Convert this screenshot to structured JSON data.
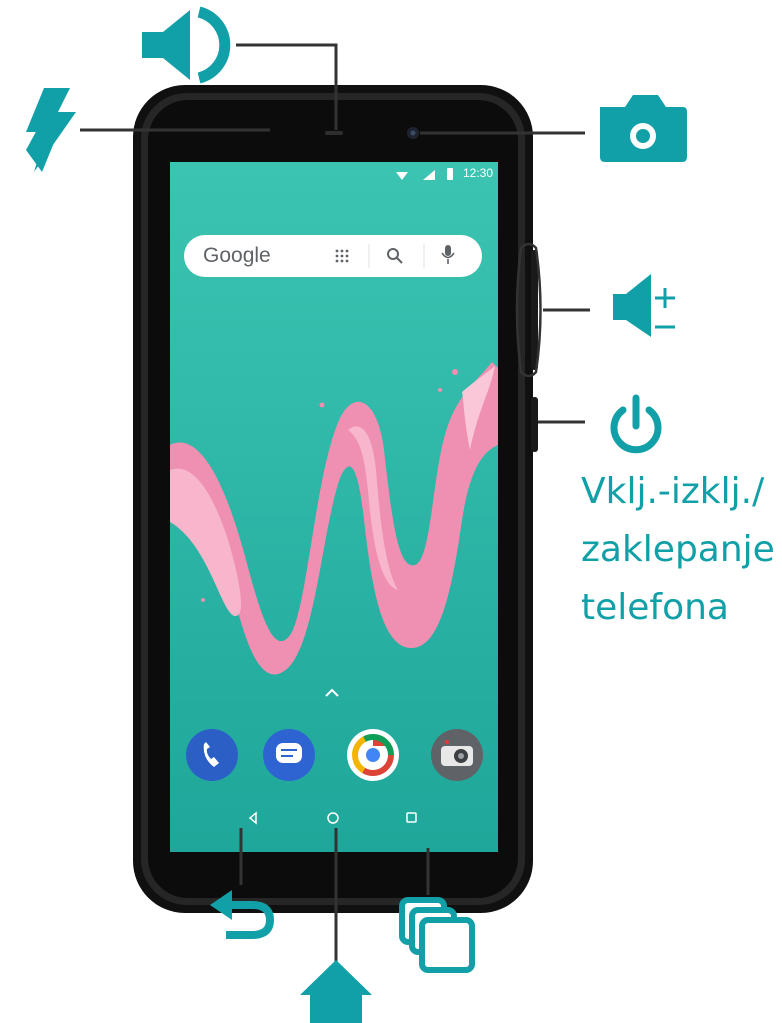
{
  "colors": {
    "accent": "#12a0a8",
    "screen": "#28b5a3",
    "phone_body": "#1a1a1a",
    "leader_line": "#333333",
    "splash_pink": "#ef8fb2"
  },
  "callouts": {
    "speaker": {
      "icon": "speaker-icon"
    },
    "charging": {
      "icon": "lightning-icon"
    },
    "camera": {
      "icon": "camera-icon"
    },
    "volume": {
      "icon": "volume-icon"
    },
    "power": {
      "icon": "power-icon",
      "label_lines": [
        "Vklj.-izklj./",
        "zaklepanje",
        "telefona"
      ]
    },
    "back": {
      "icon": "back-arrow-icon"
    },
    "home": {
      "icon": "home-icon"
    },
    "recent": {
      "icon": "recent-apps-icon"
    }
  },
  "screen": {
    "status_time": "12:30",
    "search_logo": "Google",
    "dock_apps": [
      "phone-app-icon",
      "messages-app-icon",
      "chrome-app-icon",
      "camera-app-icon"
    ]
  }
}
